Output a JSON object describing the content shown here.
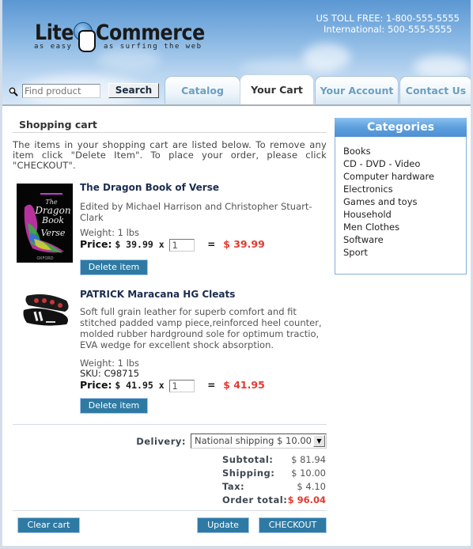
{
  "header": {
    "logo_word1": "Lite",
    "logo_word2": "Commerce",
    "logo_tag1": "as easy",
    "logo_tag2": "as surfing the web",
    "toll_free": "US TOLL FREE: 1-800-555-5555",
    "international": "International: 500-555-5555",
    "search": {
      "placeholder": "Find product",
      "button_label": "Search"
    },
    "tabs": [
      {
        "label": "Catalog",
        "active": false
      },
      {
        "label": "Your Cart",
        "active": true
      },
      {
        "label": "Your Account",
        "active": false
      },
      {
        "label": "Contact Us",
        "active": false
      }
    ]
  },
  "cart": {
    "title": "Shopping cart",
    "intro": "The items in your shopping cart are listed below. To remove any item click \"Delete Item\". To place your order, please click \"CHECKOUT\".",
    "items": [
      {
        "name": "The Dragon Book of Verse",
        "description": "Edited by Michael Harrison and Christopher Stuart-Clark",
        "weight": "Weight: 1 lbs",
        "price_label": "Price:",
        "unit_price": "$ 39.99 x",
        "quantity": "1",
        "equals": "=",
        "line_total": "$ 39.99",
        "delete_label": "Delete item"
      },
      {
        "name": "PATRICK Maracana HG Cleats",
        "description": "Soft full grain leather for superb comfort and fit stitched padded vamp piece,reinforced heel counter, molded rubber hardground sole for optimum tractio, EVA wedge for excellent shock absorption.",
        "weight": "Weight: 1 lbs",
        "sku": "SKU: C98715",
        "price_label": "Price:",
        "unit_price": "$ 41.95 x",
        "quantity": "1",
        "equals": "=",
        "line_total": "$ 41.95",
        "delete_label": "Delete item"
      }
    ],
    "delivery": {
      "label": "Delivery:",
      "selected": "National shipping $ 10.00"
    },
    "totals": {
      "subtotal_label": "Subtotal:",
      "subtotal": "$ 81.94",
      "shipping_label": "Shipping:",
      "shipping": "$ 10.00",
      "tax_label": "Tax:",
      "tax": "$ 4.10",
      "order_total_label": "Order total:",
      "order_total": "$ 96.04"
    },
    "buttons": {
      "clear": "Clear cart",
      "update": "Update",
      "checkout": "CHECKOUT"
    }
  },
  "sidebar": {
    "title": "Categories",
    "categories": [
      "Books",
      "CD - DVD - Video",
      "Computer hardware",
      "Electronics",
      "Games and toys",
      "Household",
      "Men Clothes",
      "Software",
      "Sport"
    ]
  },
  "colors": {
    "accent_button": "#2e7aa3",
    "price_red": "#e23a2f",
    "header_blue": "#5b97d3",
    "tab_text": "#6a9fc0"
  }
}
